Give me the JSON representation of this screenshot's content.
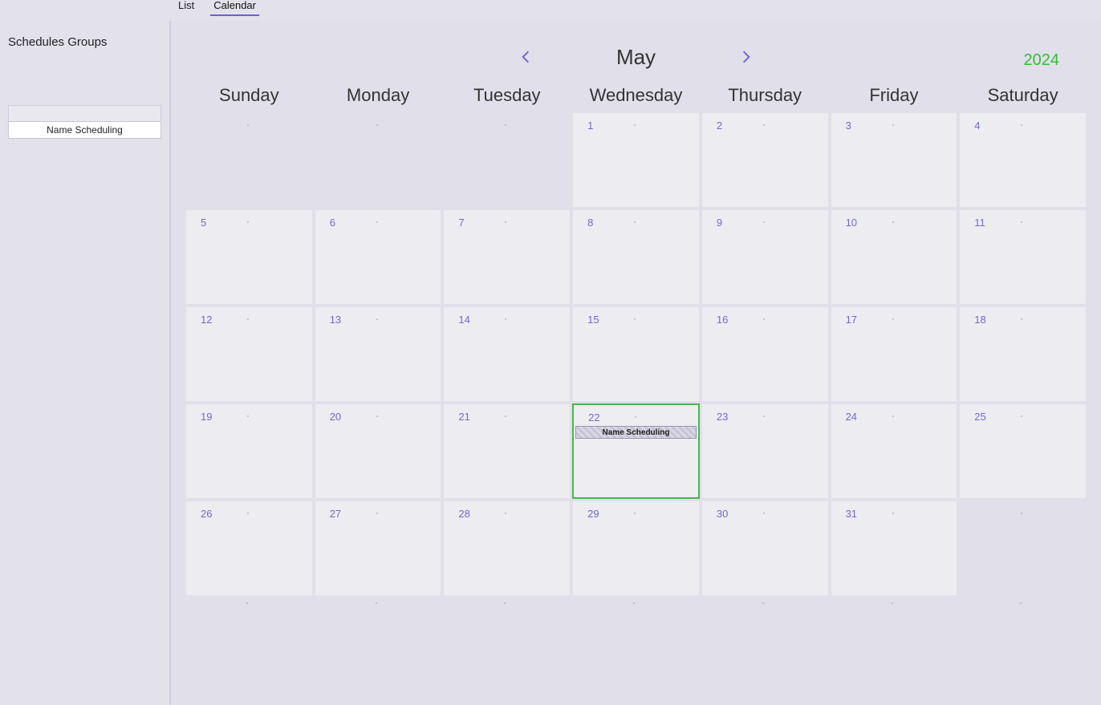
{
  "tabs": {
    "list": "List",
    "calendar": "Calendar",
    "active": "calendar"
  },
  "sidebar": {
    "heading": "Schedules Groups",
    "groups": [
      "Name Scheduling"
    ]
  },
  "calendar": {
    "month": "May",
    "year": "2024",
    "dow": [
      "Sunday",
      "Monday",
      "Tuesday",
      "Wednesday",
      "Thursday",
      "Friday",
      "Saturday"
    ],
    "today": 22,
    "weeks": [
      [
        null,
        null,
        null,
        1,
        2,
        3,
        4
      ],
      [
        5,
        6,
        7,
        8,
        9,
        10,
        11
      ],
      [
        12,
        13,
        14,
        15,
        16,
        17,
        18
      ],
      [
        19,
        20,
        21,
        22,
        23,
        24,
        25
      ],
      [
        26,
        27,
        28,
        29,
        30,
        31,
        null
      ]
    ],
    "events": {
      "22": "Name Scheduling"
    }
  }
}
